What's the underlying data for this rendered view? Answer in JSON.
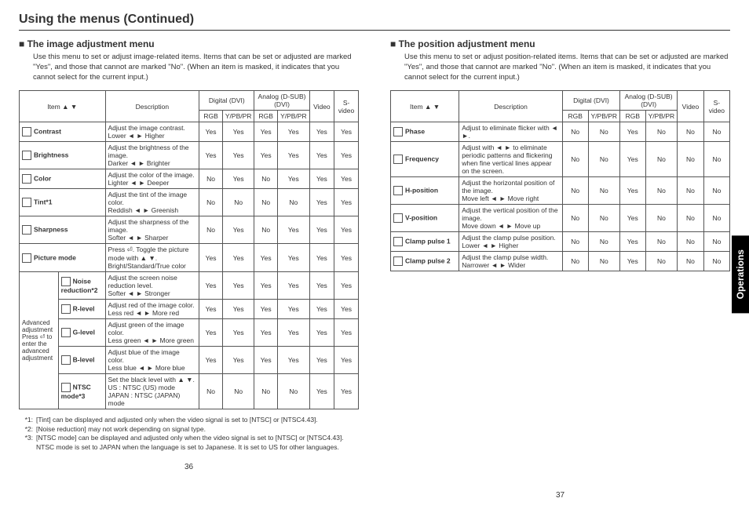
{
  "title": "Using the menus (Continued)",
  "left": {
    "heading": "The image adjustment menu",
    "intro": "Use this menu to set or adjust image-related items. Items that can be set or adjusted are marked \"Yes\", and those that cannot are marked \"No\". (When an item is masked, it indicates that you cannot select for the current input.)",
    "headerRow1": {
      "item": "Item ▲ ▼",
      "desc": "Description",
      "dvi": "Digital (DVI)",
      "dsub": "Analog (D-SUB)(DVI)",
      "video": "Video",
      "svideo": "S-video"
    },
    "headerRow2": {
      "r1": "RGB",
      "y1": "Y/PB/PR",
      "r2": "RGB",
      "y2": "Y/PB/PR"
    },
    "rows": [
      {
        "item": "Contrast",
        "desc": "Adjust the image contrast.\nLower ◄ ► Higher",
        "v": [
          "Yes",
          "Yes",
          "Yes",
          "Yes",
          "Yes",
          "Yes"
        ]
      },
      {
        "item": "Brightness",
        "desc": "Adjust the brightness of the image.\nDarker ◄ ► Brighter",
        "v": [
          "Yes",
          "Yes",
          "Yes",
          "Yes",
          "Yes",
          "Yes"
        ]
      },
      {
        "item": "Color",
        "desc": "Adjust the color of the image.\nLighter ◄ ► Deeper",
        "v": [
          "No",
          "Yes",
          "No",
          "Yes",
          "Yes",
          "Yes"
        ]
      },
      {
        "item": "Tint*1",
        "desc": "Adjust the tint of the image color.\nReddish ◄ ► Greenish",
        "v": [
          "No",
          "No",
          "No",
          "No",
          "Yes",
          "Yes"
        ]
      },
      {
        "item": "Sharpness",
        "desc": "Adjust the sharpness of the image.\nSofter ◄ ► Sharper",
        "v": [
          "No",
          "Yes",
          "No",
          "Yes",
          "Yes",
          "Yes"
        ]
      },
      {
        "item": "Picture mode",
        "desc": "Press ⏎. Toggle the picture mode with ▲ ▼.\nBright/Standard/True color",
        "v": [
          "Yes",
          "Yes",
          "Yes",
          "Yes",
          "Yes",
          "Yes"
        ]
      }
    ],
    "advLabel": "Advanced adjustment\nPress ⏎ to enter the advanced adjustment",
    "advRows": [
      {
        "item": "Noise reduction*2",
        "desc": "Adjust the screen noise reduction level.\nSofter ◄ ► Stronger",
        "v": [
          "Yes",
          "Yes",
          "Yes",
          "Yes",
          "Yes",
          "Yes"
        ]
      },
      {
        "item": "R-level",
        "desc": "Adjust red of the image color.\nLess red ◄ ► More red",
        "v": [
          "Yes",
          "Yes",
          "Yes",
          "Yes",
          "Yes",
          "Yes"
        ]
      },
      {
        "item": "G-level",
        "desc": "Adjust green of the image color.\nLess green ◄ ► More green",
        "v": [
          "Yes",
          "Yes",
          "Yes",
          "Yes",
          "Yes",
          "Yes"
        ]
      },
      {
        "item": "B-level",
        "desc": "Adjust blue of the image color.\nLess blue ◄ ► More blue",
        "v": [
          "Yes",
          "Yes",
          "Yes",
          "Yes",
          "Yes",
          "Yes"
        ]
      },
      {
        "item": "NTSC mode*3",
        "desc": "Set the black level with ▲ ▼.\nUS : NTSC (US) mode\nJAPAN : NTSC (JAPAN) mode",
        "v": [
          "No",
          "No",
          "No",
          "No",
          "Yes",
          "Yes"
        ]
      }
    ],
    "fn1": "[Tint] can be displayed and adjusted only when the video signal is set to [NTSC] or [NTSC4.43].",
    "fn2": "[Noise reduction] may not work depending on signal type.",
    "fn3": "[NTSC mode] can be displayed and adjusted only when the video signal is set to [NTSC] or [NTSC4.43]. NTSC mode is set to JAPAN when the language is set to Japanese. It is set to US for other languages.",
    "page": "36"
  },
  "right": {
    "heading": "The position adjustment menu",
    "intro": "Use this menu to set or adjust position-related items. Items that can be set or adjusted are marked \"Yes\", and those that cannot are marked \"No\". (When an item is masked, it indicates that you cannot select for the current input.)",
    "rows": [
      {
        "item": "Phase",
        "desc": "Adjust to eliminate flicker with ◄ ►.",
        "v": [
          "No",
          "No",
          "Yes",
          "No",
          "No",
          "No"
        ]
      },
      {
        "item": "Frequency",
        "desc": "Adjust with ◄ ► to eliminate periodic patterns and flickering when fine vertical lines appear on the screen.",
        "v": [
          "No",
          "No",
          "Yes",
          "No",
          "No",
          "No"
        ]
      },
      {
        "item": "H-position",
        "desc": "Adjust the horizontal position of the image.\nMove left ◄ ► Move right",
        "v": [
          "No",
          "No",
          "Yes",
          "No",
          "No",
          "No"
        ]
      },
      {
        "item": "V-position",
        "desc": "Adjust the vertical position of the image.\nMove down ◄ ► Move up",
        "v": [
          "No",
          "No",
          "Yes",
          "No",
          "No",
          "No"
        ]
      },
      {
        "item": "Clamp pulse 1",
        "desc": "Adjust the clamp pulse position.\nLower ◄ ► Higher",
        "v": [
          "No",
          "No",
          "Yes",
          "No",
          "No",
          "No"
        ]
      },
      {
        "item": "Clamp pulse 2",
        "desc": "Adjust the clamp pulse width.\nNarrower ◄ ► Wider",
        "v": [
          "No",
          "No",
          "Yes",
          "No",
          "No",
          "No"
        ]
      }
    ],
    "page": "37"
  },
  "sideTab": "Operations"
}
